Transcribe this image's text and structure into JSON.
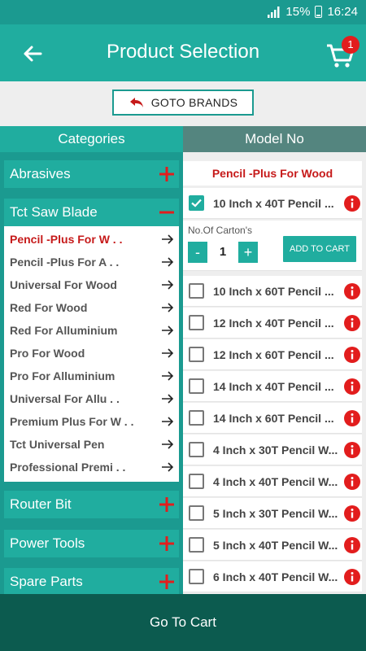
{
  "status_bar": {
    "battery_pct": "15%",
    "time": "16:24"
  },
  "app_bar": {
    "title": "Product Selection",
    "cart_count": "1"
  },
  "goto_brands_label": "GOTO BRANDS",
  "tabs": {
    "categories": "Categories",
    "model_no": "Model No"
  },
  "categories": [
    {
      "label": "Abrasives",
      "expanded": false
    },
    {
      "label": "Tct Saw Blade",
      "expanded": true
    },
    {
      "label": "Router Bit",
      "expanded": false
    },
    {
      "label": "Power Tools",
      "expanded": false
    },
    {
      "label": "Spare Parts",
      "expanded": false
    }
  ],
  "sub_categories": [
    {
      "label": "Pencil -Plus For W . .",
      "active": true
    },
    {
      "label": "Pencil -Plus For A . .",
      "active": false
    },
    {
      "label": "Universal For Wood",
      "active": false
    },
    {
      "label": "Red For Wood",
      "active": false
    },
    {
      "label": "Red For Alluminium",
      "active": false
    },
    {
      "label": "Pro For Wood",
      "active": false
    },
    {
      "label": "Pro For Alluminium",
      "active": false
    },
    {
      "label": "Universal For Allu . .",
      "active": false
    },
    {
      "label": "Premium Plus For W . .",
      "active": false
    },
    {
      "label": "Tct Universal Pen",
      "active": false
    },
    {
      "label": "Professional Premi . .",
      "active": false
    }
  ],
  "brand_title": "Pencil -Plus For Wood",
  "quantity": {
    "label": "No.Of Carton's",
    "value": "1",
    "minus": "-",
    "plus": "+",
    "add_to_cart": "ADD TO CART"
  },
  "models": [
    {
      "label": "10 Inch x 40T Pencil ...",
      "checked": true
    },
    {
      "label": "10 Inch x 60T Pencil ...",
      "checked": false
    },
    {
      "label": "12 Inch x 40T Pencil ...",
      "checked": false
    },
    {
      "label": "12 Inch x 60T Pencil ...",
      "checked": false
    },
    {
      "label": "14 Inch x 40T Pencil ...",
      "checked": false
    },
    {
      "label": "14 Inch x 60T Pencil ...",
      "checked": false
    },
    {
      "label": "4 Inch x 30T Pencil W...",
      "checked": false
    },
    {
      "label": "4 Inch x 40T Pencil W...",
      "checked": false
    },
    {
      "label": "5 Inch x 30T Pencil W...",
      "checked": false
    },
    {
      "label": "5 Inch x 40T Pencil W...",
      "checked": false
    },
    {
      "label": "6 Inch x 40T Pencil W...",
      "checked": false
    }
  ],
  "go_to_cart": "Go To Cart",
  "colors": {
    "primary": "#20ad9f",
    "dark": "#0c5b4f",
    "accent_red": "#c61a1a",
    "badge_red": "#e21d1d"
  }
}
